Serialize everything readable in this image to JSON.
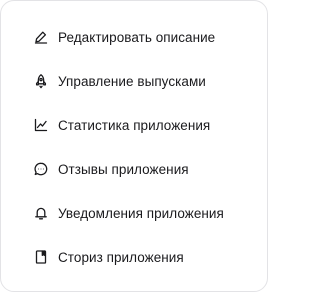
{
  "menu": {
    "items": [
      {
        "label": "Редактировать описание",
        "icon": "pencil-icon"
      },
      {
        "label": "Управление выпусками",
        "icon": "rocket-icon"
      },
      {
        "label": "Статистика приложения",
        "icon": "line-chart-icon"
      },
      {
        "label": "Отзывы приложения",
        "icon": "chat-bubble-icon"
      },
      {
        "label": "Уведомления приложения",
        "icon": "bell-icon"
      },
      {
        "label": "Сториз приложения",
        "icon": "bookmark-card-icon"
      }
    ],
    "colors": {
      "text": "#1a1a1d",
      "icon": "#1a1a1d",
      "border": "#e3e3e6",
      "background": "#ffffff"
    }
  }
}
